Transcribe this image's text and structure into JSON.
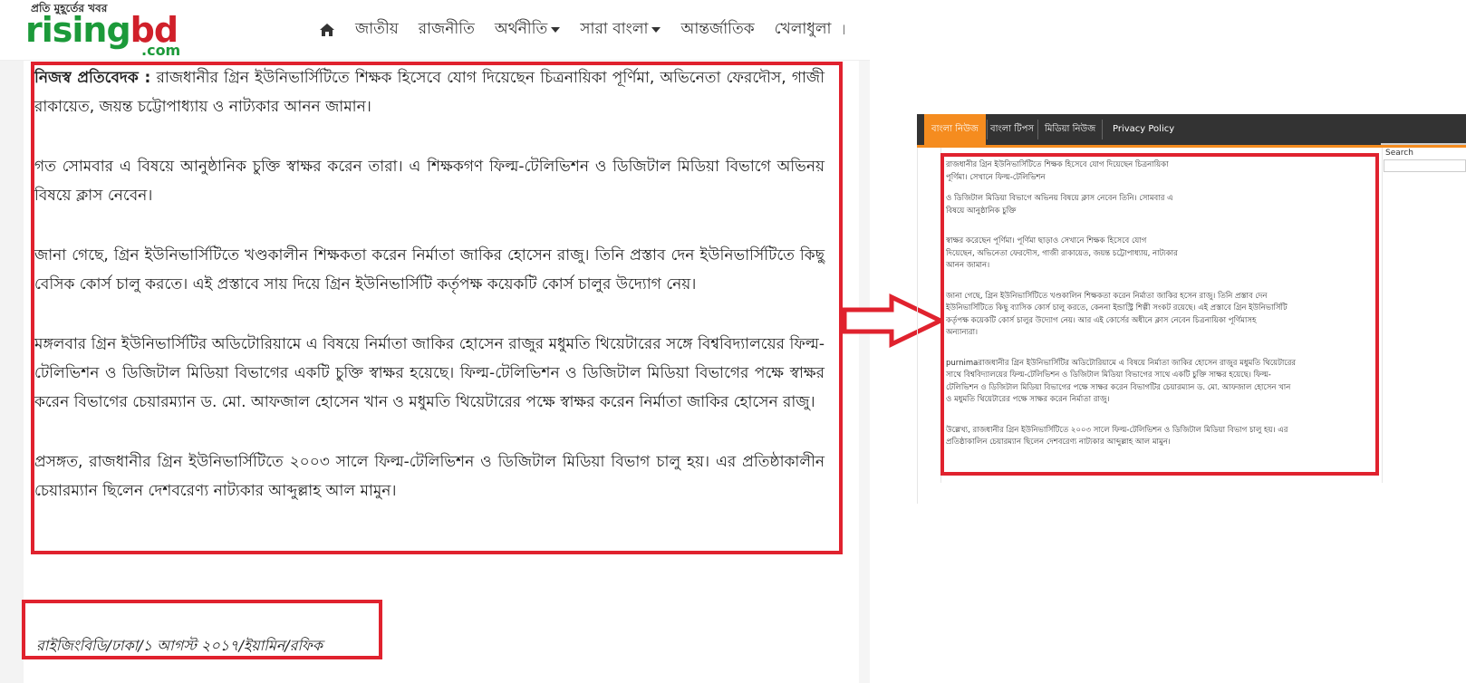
{
  "left_page": {
    "logo": {
      "tagline": "প্রতি মুহূর্তের খবর",
      "word_main": "rising",
      "word_accent": "bd",
      "domain": ".com"
    },
    "nav": {
      "home_icon": "home-icon",
      "items": [
        "জাতীয়",
        "রাজনীতি",
        "অর্থনীতি",
        "সারা বাংলা",
        "আন্তর্জাতিক",
        "খেলাধুলা"
      ],
      "edge_char": "।"
    },
    "article": {
      "byline": "নিজস্ব প্রতিবেদক :",
      "p1": "রাজধানীর গ্রিন ইউনিভার্সিটিতে শিক্ষক হিসেবে যোগ দিয়েছেন চিত্রনায়িকা পূর্ণিমা, অভিনেতা ফেরদৌস, গাজী রাকায়েত, জয়ন্ত চট্টোপাধ্যায় ও নাট্যকার আনন জামান।",
      "p2": "গত সোমবার এ বিষয়ে আনুষ্ঠানিক চুক্তি স্বাক্ষর করেন তারা। এ শিক্ষকগণ ফিল্ম-টেলিভিশন ও ডিজিটাল মিডিয়া বিভাগে অভিনয় বিষয়ে ক্লাস নেবেন।",
      "p3": "জানা গেছে, গ্রিন ইউনিভার্সিটিতে খণ্ডকালীন শিক্ষকতা করেন নির্মাতা জাকির হোসেন রাজু। তিনি প্রস্তাব দেন ইউনিভার্সিটিতে কিছু বেসিক কোর্স চালু করতে। এই প্রস্তাবে সায় দিয়ে গ্রিন ইউনিভার্সিটি কর্তৃপক্ষ কয়েকটি কোর্স চালুর উদ্যোগ নেয়।",
      "p4": "মঙ্গলবার গ্রিন ইউনিভার্সিটির অডিটোরিয়ামে এ বিষয়ে নির্মাতা জাকির হোসেন রাজুর মধুমতি থিয়েটারের সঙ্গে বিশ্ববিদ্যালয়ের ফিল্ম-টেলিভিশন ও ডিজিটাল মিডিয়া বিভাগের একটি চুক্তি স্বাক্ষর হয়েছে। ফিল্ম-টেলিভিশন ও ডিজিটাল মিডিয়া বিভাগের পক্ষে স্বাক্ষর করেন বিভাগের চেয়ারম্যান ড. মো. আফজাল হোসেন খান ও মধুমতি থিয়েটারের পক্ষে স্বাক্ষর করেন নির্মাতা জাকির হোসেন রাজু।",
      "p5": "প্রসঙ্গত, রাজধানীর গ্রিন ইউনিভার্সিটিতে ২০০৩ সালে ফিল্ম-টেলিভিশন ও ডিজিটাল মিডিয়া বিভাগ চালু হয়। এর প্রতিষ্ঠাকালীন চেয়ারম্যান ছিলেন দেশবরেণ্য নাট্যকার আব্দুল্লাহ আল মামুন।"
    },
    "signature": "রাইজিংবিডি/ঢাকা/১ আগস্ট ২০১৭/ইয়ামিন/রফিক"
  },
  "right_page": {
    "tabs": [
      "বাংলা নিউজ",
      "বাংলা টিপস",
      "মিডিয়া নিউজ",
      "Privacy Policy"
    ],
    "search_label": "Search",
    "paragraphs": [
      [
        "রাজধানীর গ্রিন ইউনিভার্সিটিতে শিক্ষক হিসেবে যোগ দিয়েছেন চিত্রনায়িকা",
        "পূর্ণিমা। সেখানে ফিল্ম-টেলিভিশন"
      ],
      [
        "ও ডিজিটাল মিডিয়া বিভাগে অভিনয় বিষয়ে ক্লাস নেবেন তিনি। সোমবার এ",
        "বিষয়ে আনুষ্ঠানিক চুক্তি"
      ],
      [
        "স্বাক্ষর করেছেন পূর্ণিমা। পূর্ণিমা ছাড়াও সেখানে শিক্ষক হিসেবে যোগ",
        "দিয়েছেন, অভিনেতা ফেরদৌস, গাজী রাকায়েত, জয়ন্ত চট্টোপাধ্যায়, নাট্যকার",
        "আনন জামান।"
      ],
      [
        "জানা গেছে, গ্রিন ইউনিভার্সিটিতে খণ্ডকালিন শিক্ষকতা করেন নির্মাতা জাকির হসেন রাজু। তিনি প্রস্তাব দেন",
        "ইউনিভার্সিটিতে কিছু ব্যাসিক কোর্স চালু করতে, কেননা ইন্ডাস্ট্রি শিল্পী সংকট রয়েছে। এই প্রস্তাবে গ্রিন ইউনিভার্সিটি",
        "কর্তৃপক্ষ কয়েকটি কোর্স চালুর উদ্যোগ নেয়। আর এই কোর্সের অধীনে ক্লাস নেবেন চিত্রনায়িকা পূর্ণিমাসহ",
        "অন্যান্যরা।"
      ],
      [
        "purnimaরাজধানীর গ্রিন ইউনিভার্সিটির অডিটোরিয়ামে এ বিষয়ে নির্মাতা জাকির হোসেন রাজুর মধুমতি থিয়েটারের",
        "সাথে বিশ্ববিদ্যালয়ের ফিল্ম-টেলিভিশন ও ডিজিটাল মিডিয়া বিভাগের সাথে একটি চুক্তি সাক্ষর হয়েছে। ফিল্ম-",
        "টেলিভিশন ও ডিজিটাল মিডিয়া বিভাগের পক্ষে সাক্ষর করেন বিভাগটির চেয়ারম্যান ড. মো. আফজাল হোসেন খান",
        "ও মধুমতি থিয়েটারের পক্ষে সাক্ষর করেন নির্মাতা রাজু।"
      ],
      [
        "উল্লেখ্য, রাজধানীর গ্রিন ইউনিভার্সিটিতে ২০০৩ সালে ফিল্ম-টেলিভিশন ও ডিজিটাল মিডিয়া বিভাগ চালু হয়। এর",
        "প্রতিষ্ঠাকালিন চেয়ারম্যান ছিলেন দেশবরেণ্য নাট্যকার আব্দুল্লাহ আল মামুন।"
      ]
    ]
  },
  "colors": {
    "highlight_red": "#e0222e",
    "logo_green": "#1c9a3a",
    "logo_red": "#d0202a",
    "tab_orange": "#f58c1f",
    "navbar_dark": "#333333"
  }
}
